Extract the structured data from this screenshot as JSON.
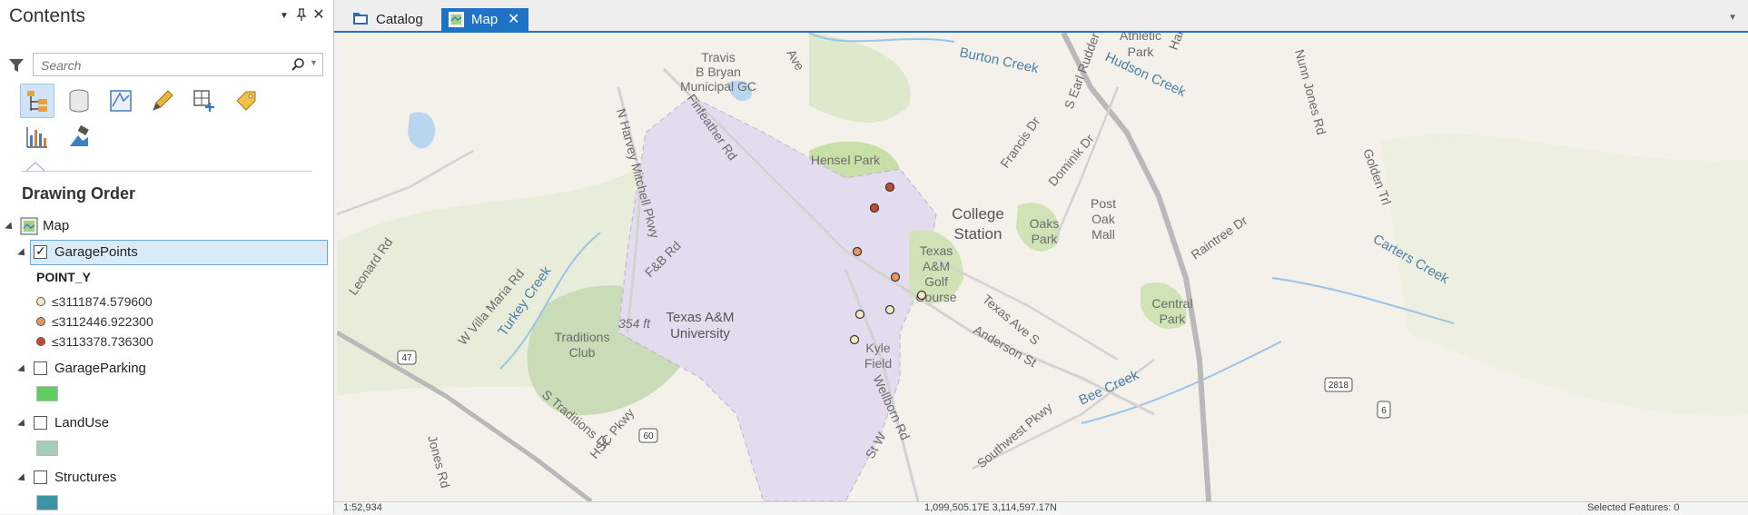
{
  "contents": {
    "title": "Contents",
    "search_placeholder": "Search",
    "section_label": "Drawing Order",
    "map_label": "Map",
    "layers": [
      {
        "name": "GaragePoints",
        "checked": true,
        "field": "POINT_Y",
        "classes": [
          "≤3111874.579600",
          "≤3112446.922300",
          "≤3113378.736300"
        ],
        "class_colors": [
          "#f5e7c4",
          "#e89660",
          "#c84a2e"
        ]
      },
      {
        "name": "GarageParking",
        "checked": false,
        "color": "#5fcd5f"
      },
      {
        "name": "LandUse",
        "checked": false,
        "color": "#a6cbb7"
      },
      {
        "name": "Structures",
        "checked": false,
        "color": "#3e94a7"
      }
    ]
  },
  "tabs": {
    "catalog": "Catalog",
    "map": "Map"
  },
  "map": {
    "labels": {
      "burton_creek": "Burton Creek",
      "travis": "Travis",
      "b_bryan": "B Bryan",
      "municipal_gc": "Municipal GC",
      "finfeather_rd": "Finfeather Rd",
      "n_harvey_mitchell": "N Harvey Mitchell Pkwy",
      "hensel_park": "Hensel Park",
      "college": "College",
      "station": "Station",
      "francis_dr": "Francis Dr",
      "dominik_dr": "Dominik Dr",
      "oaks": "Oaks",
      "park": "Park",
      "post": "Post",
      "oak": "Oak",
      "mall": "Mall",
      "s_earl_rudder": "S Earl Rudder Fwy",
      "hudson_creek": "Hudson Creek",
      "athletic": "Athletic",
      "athletic_park": "Park",
      "nunn_jones_rd": "Nunn Jones Rd",
      "golden_trl": "Golden Trl",
      "raintree_dr": "Raintree Dr",
      "carters_creek": "Carters Creek",
      "central": "Central",
      "central_park": "Park",
      "leonard_rd": "Leonard Rd",
      "turkey_creek": "Turkey Creek",
      "w_villa_maria": "W Villa Maria Rd",
      "traditions": "Traditions",
      "club": "Club",
      "elevation": "354 ft",
      "fb_rd": "F&B Rd",
      "texas_am": "Texas A&M",
      "university": "University",
      "tamu_golf_1": "Texas",
      "tamu_golf_2": "A&M",
      "tamu_golf_3": "Golf",
      "tamu_golf_4": "Course",
      "kyle": "Kyle",
      "field": "Field",
      "texas_ave": "Texas Ave S",
      "anderson_st": "Anderson St",
      "wellborn_rd": "Wellborn Rd",
      "southwest_pkwy": "Southwest Pkwy",
      "bee_creek": "Bee Creek",
      "s_traditions_dr": "S Traditions Dr",
      "hsc_pkwy": "HSC Pkwy",
      "jones_rd": "Jones Rd",
      "hwy_47": "47",
      "hwy_60": "60",
      "hwy_2818": "2818",
      "hwy_6": "6",
      "ave": "Ave",
      "harv": "Harv",
      "st_w": "St W"
    }
  },
  "status": {
    "scale": "1:52,934",
    "coords": "1,099,505.17E 3,114,597.17N",
    "selected": "Selected Features: 0"
  }
}
